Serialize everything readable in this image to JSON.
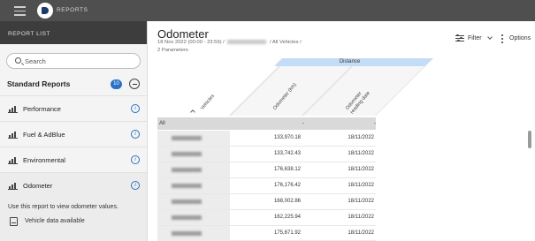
{
  "app": {
    "title": "REPORTS"
  },
  "sidebar": {
    "header": "REPORT LIST",
    "search": {
      "placeholder": "Search",
      "value": ""
    },
    "section": {
      "title": "Standard Reports",
      "count": "10"
    },
    "items": [
      {
        "label": "Performance",
        "icon": "bar-chart-icon"
      },
      {
        "label": "Fuel & AdBlue",
        "icon": "bar-chart-icon"
      },
      {
        "label": "Environmental",
        "icon": "bar-chart-icon"
      },
      {
        "label": "Odometer",
        "icon": "bar-chart-icon",
        "selected": true
      }
    ],
    "description": "Use this report to view odometer values.",
    "vehicle_data": "Vehicle data available"
  },
  "main": {
    "title": "Odometer",
    "subtitle_prefix": "18 Nov 2022 (00:00 - 23:59) /",
    "subtitle_suffix": "/ All Vehicles /",
    "subtitle2": "2 Parameters",
    "filter_label": "Filter",
    "options_label": "Options"
  },
  "table": {
    "group_header": "Distance",
    "columns": [
      "Vehicles",
      "Odometer (km)",
      "Odometer reading date"
    ],
    "filter_row": [
      "All",
      "-",
      "-"
    ],
    "rows": [
      {
        "odometer": "133,970.18",
        "date": "18/11/2022"
      },
      {
        "odometer": "133,742.43",
        "date": "18/11/2022"
      },
      {
        "odometer": "176,638.12",
        "date": "18/11/2022"
      },
      {
        "odometer": "176,176.42",
        "date": "18/11/2022"
      },
      {
        "odometer": "168,002.86",
        "date": "18/11/2022"
      },
      {
        "odometer": "162,225.94",
        "date": "18/11/2022"
      },
      {
        "odometer": "175,671.92",
        "date": "18/11/2022"
      },
      {
        "odometer": "",
        "date": ""
      }
    ]
  },
  "colors": {
    "topbar": "#4f4f4f",
    "accent": "#2a72c4",
    "group_header": "#c4ddf6"
  }
}
